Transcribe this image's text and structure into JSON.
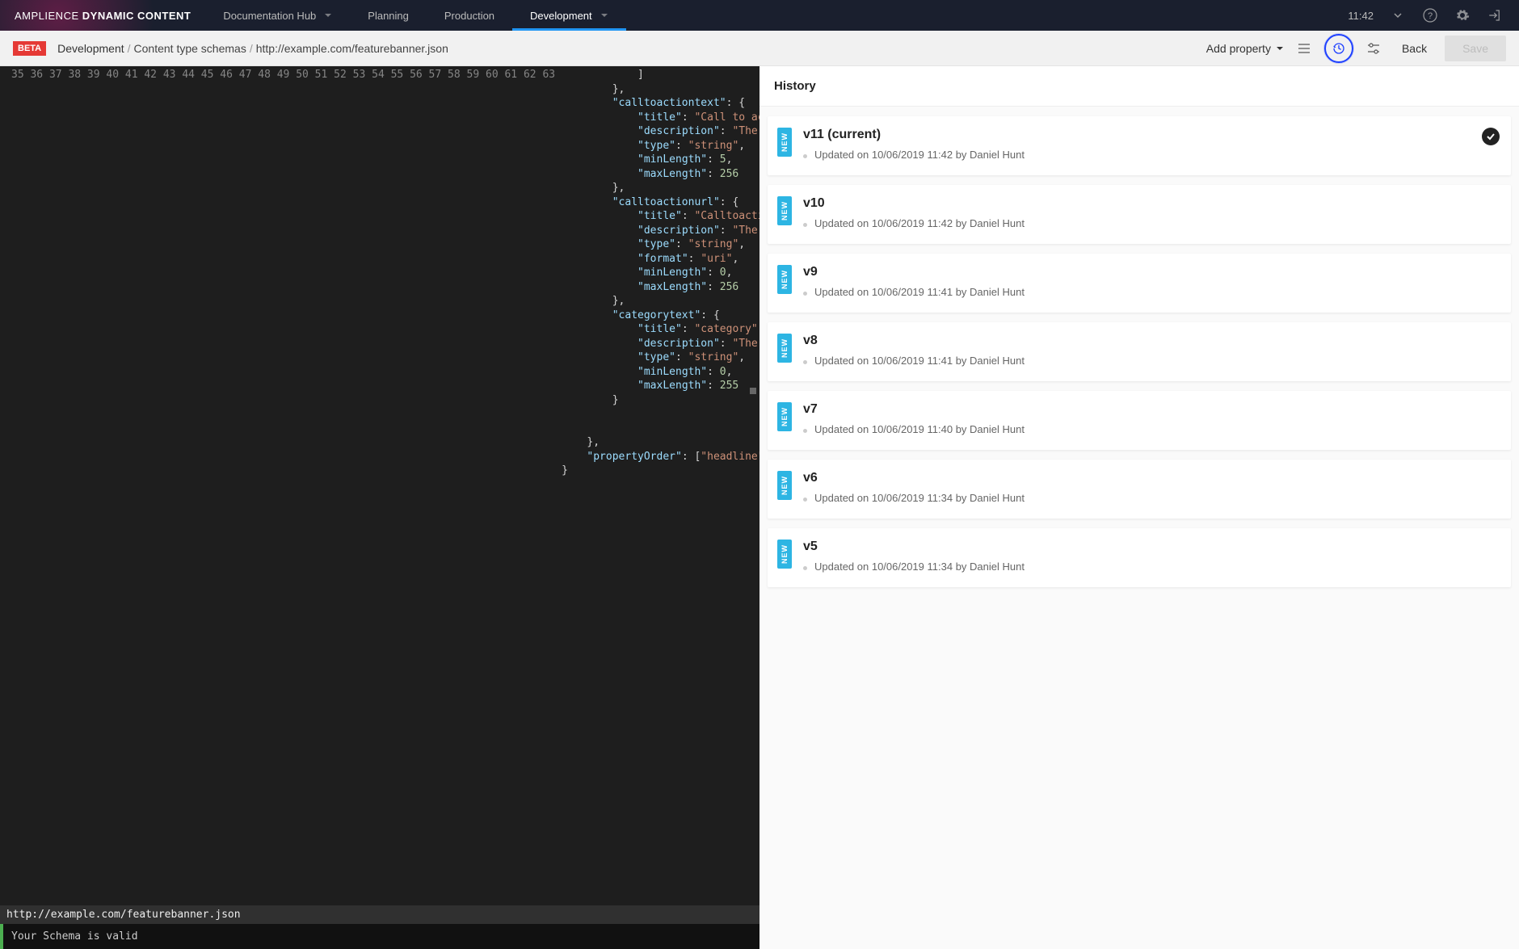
{
  "header": {
    "brand_light": "AMPLIENCE",
    "brand_bold": "DYNAMIC CONTENT",
    "tabs": [
      {
        "label": "Documentation Hub",
        "has_caret": true
      },
      {
        "label": "Planning"
      },
      {
        "label": "Production"
      },
      {
        "label": "Development",
        "has_caret": true,
        "active": true
      }
    ],
    "clock": "11:42"
  },
  "subbar": {
    "beta": "BETA",
    "crumbs": [
      "Development",
      "Content type schemas",
      "http://example.com/featurebanner.json"
    ],
    "add_property": "Add property",
    "back": "Back",
    "save": "Save"
  },
  "editor": {
    "line_start": 35,
    "lines": [
      "            ]",
      "        },",
      "        \"calltoactiontext\": {",
      "            \"title\": \"Call to action text\",",
      "            \"description\": \"The text for the call to action\",",
      "            \"type\": \"string\",",
      "            \"minLength\": 5,",
      "            \"maxLength\": 256",
      "        },",
      "        \"calltoactionurl\": {",
      "            \"title\": \"Calltoactionurl\",",
      "            \"description\": \"The URL to be used in the call to action\",",
      "            \"type\": \"string\",",
      "            \"format\": \"uri\",",
      "            \"minLength\": 0,",
      "            \"maxLength\": 256",
      "        },",
      "        \"categorytext\": {",
      "            \"title\": \"category\",",
      "            \"description\": \"The item category\",",
      "            \"type\": \"string\",",
      "            \"minLength\": 0,",
      "            \"maxLength\": 255",
      "        }",
      "",
      "",
      "    },",
      "    \"propertyOrder\": [\"headline\", \"strapline\", \"background\", \"calltoactiontext\", \"calltoact",
      "}"
    ],
    "footer_path": "http://example.com/featurebanner.json",
    "validation": "Your Schema is valid"
  },
  "history": {
    "title": "History",
    "items": [
      {
        "version": "v11 (current)",
        "meta": "Updated on 10/06/2019 11:42 by Daniel Hunt",
        "current": true
      },
      {
        "version": "v10",
        "meta": "Updated on 10/06/2019 11:42 by Daniel Hunt"
      },
      {
        "version": "v9",
        "meta": "Updated on 10/06/2019 11:41 by Daniel Hunt"
      },
      {
        "version": "v8",
        "meta": "Updated on 10/06/2019 11:41 by Daniel Hunt"
      },
      {
        "version": "v7",
        "meta": "Updated on 10/06/2019 11:40 by Daniel Hunt"
      },
      {
        "version": "v6",
        "meta": "Updated on 10/06/2019 11:34 by Daniel Hunt"
      },
      {
        "version": "v5",
        "meta": "Updated on 10/06/2019 11:34 by Daniel Hunt"
      }
    ],
    "new_label": "NEW"
  }
}
